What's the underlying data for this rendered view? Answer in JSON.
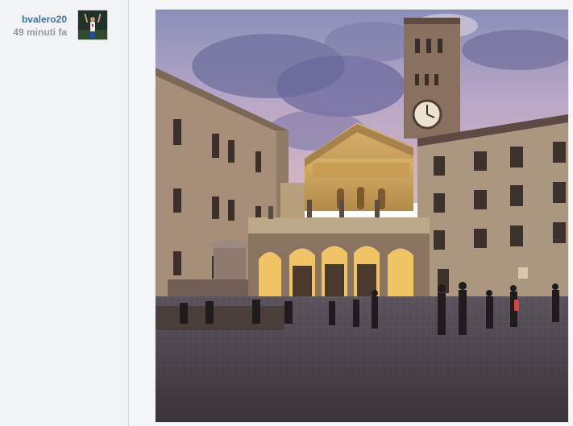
{
  "post": {
    "username": "bvalero20",
    "timestamp": "49 minuti fa"
  },
  "avatar": {
    "icon": "user-avatar-photo"
  },
  "photo": {
    "icon": "piazza-church-photo"
  }
}
